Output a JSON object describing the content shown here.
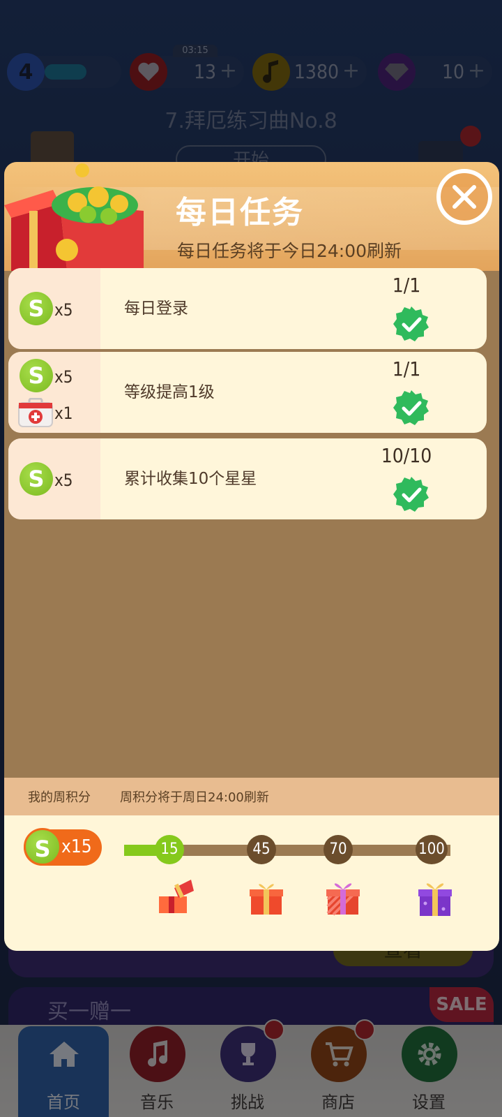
{
  "status_bar": {
    "level": "4",
    "lives": "13",
    "lives_timer": "03:15",
    "notes": "1380",
    "diamonds": "10",
    "plus": "+"
  },
  "song": {
    "title": "7.拜厄练习曲No.8",
    "start_label": "开始"
  },
  "daily_tasks": {
    "title": "每日任务",
    "subtitle": "每日任务将于今日24:00刷新",
    "tasks": [
      {
        "name": "每日登录",
        "progress": "1/1",
        "rewards": [
          {
            "icon": "coin-icon",
            "label": "S",
            "qty": "x5"
          }
        ],
        "completed": true
      },
      {
        "name": "等级提高1级",
        "progress": "1/1",
        "rewards": [
          {
            "icon": "coin-icon",
            "label": "S",
            "qty": "x5"
          },
          {
            "icon": "medkit-icon",
            "qty": "x1"
          }
        ],
        "completed": true
      },
      {
        "name": "累计收集10个星星",
        "progress": "10/10",
        "rewards": [
          {
            "icon": "coin-icon",
            "label": "S",
            "qty": "x5"
          }
        ],
        "completed": true
      }
    ]
  },
  "weekly": {
    "label": "我的周积分",
    "note": "周积分将于周日24:00刷新",
    "score_label": "S",
    "score": "x15",
    "current": 15,
    "max": 100,
    "milestones": [
      "15",
      "45",
      "70",
      "100"
    ]
  },
  "promo": {
    "title": "买一赠一",
    "sale": "SALE",
    "view_label": "查看"
  },
  "nav": {
    "home": "首页",
    "music": "音乐",
    "challenge": "挑战",
    "shop": "商店",
    "settings": "设置"
  },
  "colors": {
    "coin_green": "#7cba20",
    "check_green": "#2fba5c",
    "modal_brown": "#9b7a52",
    "header_orange": "#eab26a",
    "score_orange": "#f06a1a"
  }
}
